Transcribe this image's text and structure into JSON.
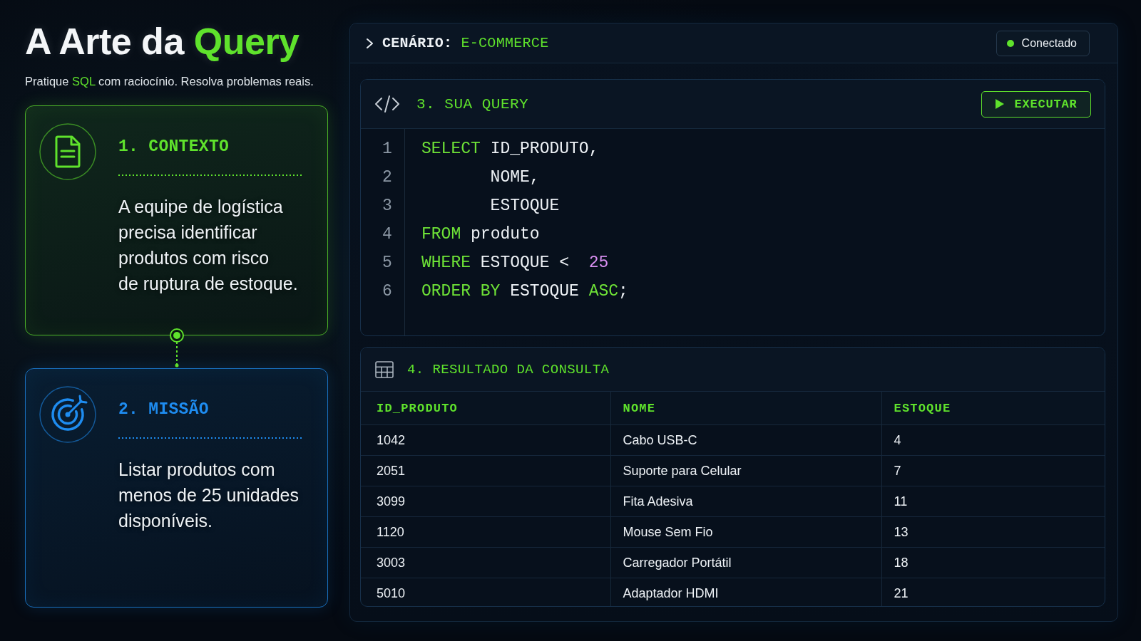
{
  "header": {
    "title": [
      {
        "text": "A Arte da",
        "highlight": false
      },
      {
        "text": "Query",
        "highlight": true
      }
    ],
    "subtitle": [
      {
        "text": "Pratique",
        "highlight": false
      },
      {
        "text": "SQL",
        "highlight": true
      },
      {
        "text": "com raciocínio. Resolva problemas reais.",
        "highlight": false
      }
    ]
  },
  "steps": [
    {
      "kind": "document",
      "color": "#5fe22c",
      "title": "1. CONTEXTO",
      "lines": [
        "A equipe de logística",
        "precisa identificar",
        "produtos com risco",
        "de ruptura de estoque."
      ]
    },
    {
      "kind": "target",
      "color": "#1e8cf0",
      "title": "2. MISSÃO",
      "lines": [
        "Listar produtos com",
        "menos de 25 unidades",
        "disponíveis."
      ]
    }
  ],
  "scenario": {
    "label": "CENÁRIO:",
    "value": "E-COMMERCE",
    "status": {
      "label": "Conectado",
      "connected": true
    }
  },
  "query": {
    "title": "3. SUA QUERY",
    "run_button": "EXECUTAR",
    "lines": [
      {
        "number": "1",
        "indented": false,
        "tokens": [
          {
            "text": "SELECT",
            "kind": "keyword"
          },
          {
            "text": " ID_PRODUTO,",
            "kind": "plain"
          }
        ]
      },
      {
        "number": "2",
        "indented": true,
        "tokens": [
          {
            "text": "NOME,",
            "kind": "plain"
          }
        ]
      },
      {
        "number": "3",
        "indented": true,
        "tokens": [
          {
            "text": "ESTOQUE",
            "kind": "plain"
          }
        ]
      },
      {
        "number": "4",
        "indented": false,
        "tokens": [
          {
            "text": "FROM",
            "kind": "keyword"
          },
          {
            "text": " produto",
            "kind": "plain"
          }
        ]
      },
      {
        "number": "5",
        "indented": false,
        "tokens": [
          {
            "text": "WHERE",
            "kind": "keyword"
          },
          {
            "text": " ESTOQUE <  ",
            "kind": "plain"
          },
          {
            "text": "25",
            "kind": "number"
          }
        ]
      },
      {
        "number": "6",
        "indented": false,
        "tokens": [
          {
            "text": "ORDER BY",
            "kind": "keyword"
          },
          {
            "text": " ESTOQUE ",
            "kind": "plain"
          },
          {
            "text": "ASC",
            "kind": "keyword"
          },
          {
            "text": ";",
            "kind": "plain"
          }
        ]
      }
    ]
  },
  "result": {
    "title": "4. RESULTADO DA CONSULTA",
    "columns": [
      "ID_PRODUTO",
      "NOME",
      "ESTOQUE"
    ],
    "rows": [
      [
        "1042",
        "Cabo USB-C",
        "4"
      ],
      [
        "2051",
        "Suporte para Celular",
        "7"
      ],
      [
        "3099",
        "Fita Adesiva",
        "11"
      ],
      [
        "1120",
        "Mouse Sem Fio",
        "13"
      ],
      [
        "3003",
        "Carregador Portátil",
        "18"
      ],
      [
        "5010",
        "Adaptador HDMI",
        "21"
      ]
    ]
  }
}
